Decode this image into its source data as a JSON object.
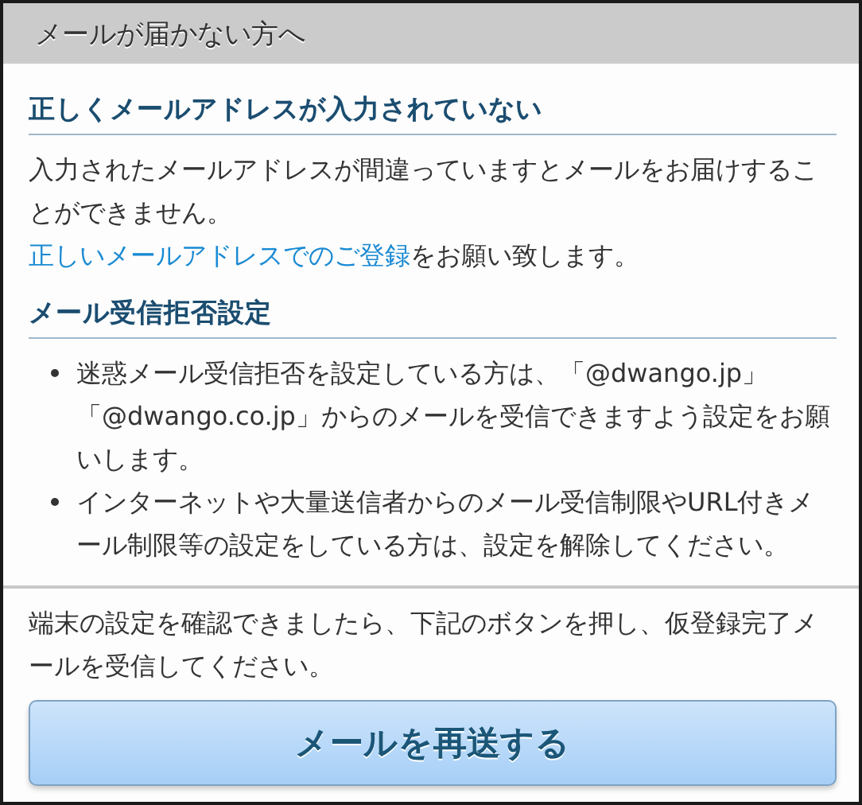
{
  "header": {
    "title": "メールが届かない方へ"
  },
  "sections": [
    {
      "heading": "正しくメールアドレスが入力されていない",
      "kind": "paragraphs",
      "paragraphs": [
        "入力されたメールアドレスが間違っていますとメールをお届けすることができません。"
      ],
      "link_line": {
        "link": "正しいメールアドレスでのご登録",
        "rest": "をお願い致します。"
      }
    },
    {
      "heading": "メール受信拒否設定",
      "kind": "bullets",
      "bullets": [
        "迷惑メール受信拒否を設定している方は、「@dwango.jp」「@dwango.co.jp」からのメールを受信できますよう設定をお願いします。",
        "インターネットや大量送信者からのメール受信制限やURL付きメール制限等の設定をしている方は、設定を解除してください。"
      ]
    }
  ],
  "footer": {
    "text": "端末の設定を確認できましたら、下記のボタンを押し、仮登録完了メールを受信してください。",
    "button": "メールを再送する"
  }
}
